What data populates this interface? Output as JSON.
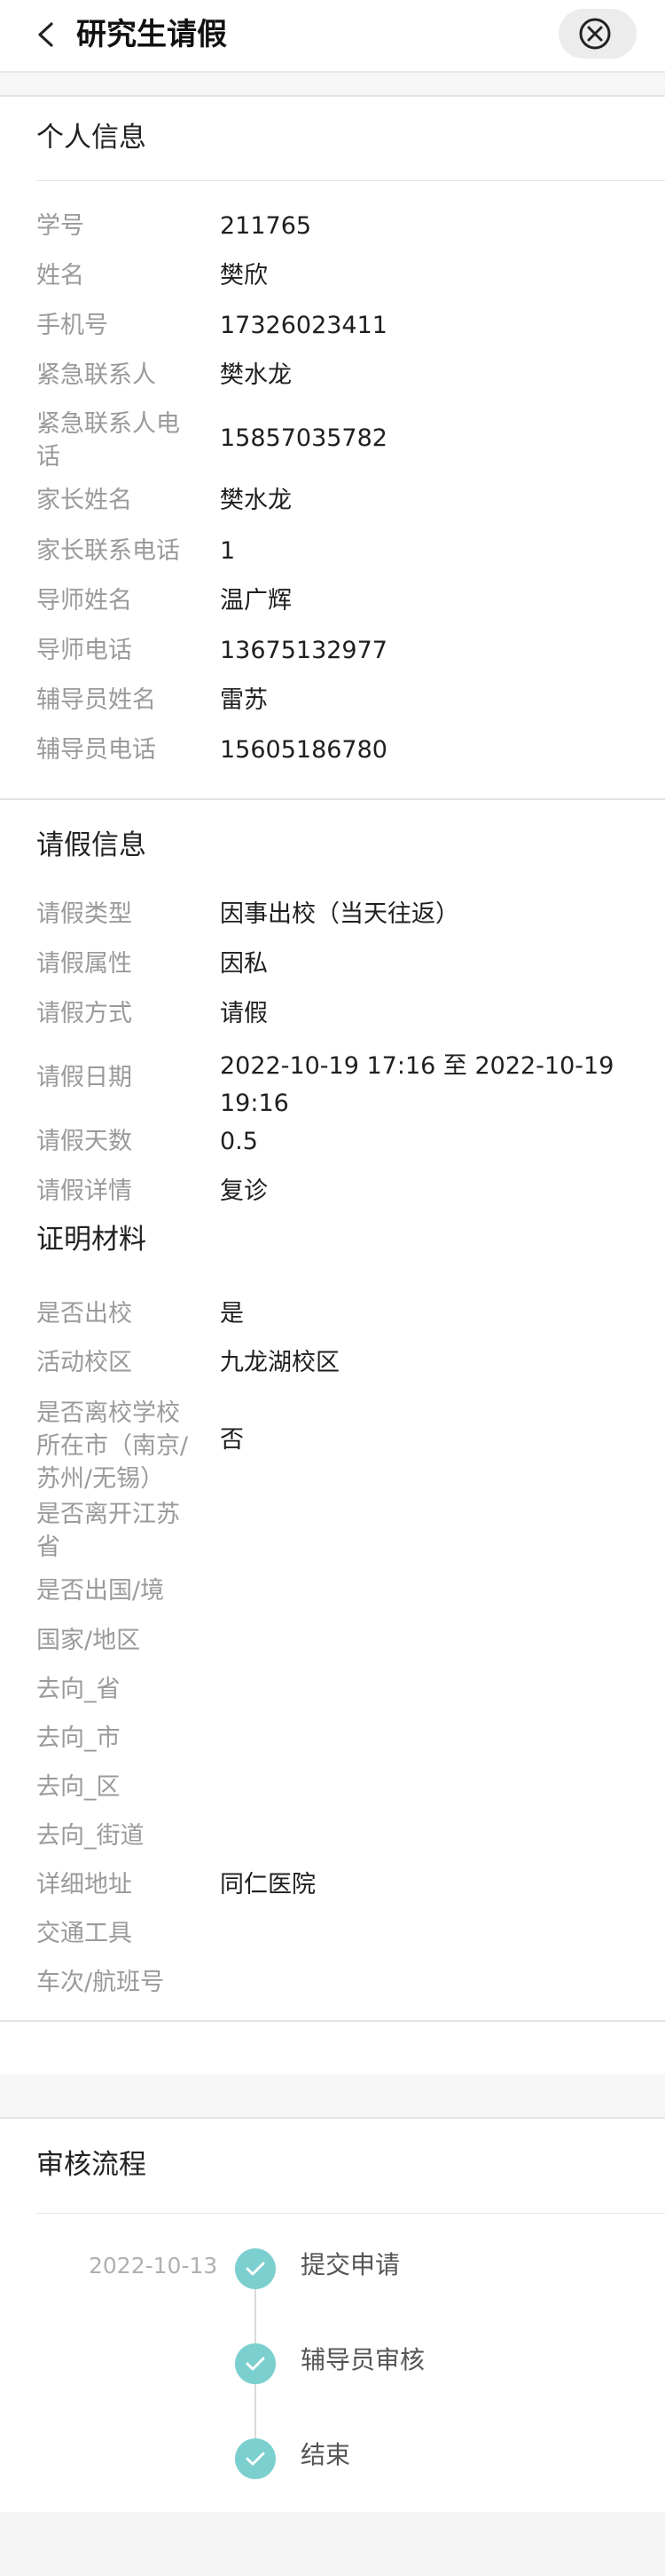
{
  "header": {
    "title": "研究生请假"
  },
  "personal": {
    "title": "个人信息",
    "rows": [
      {
        "label": "学号",
        "value": "211765"
      },
      {
        "label": "姓名",
        "value": "樊欣"
      },
      {
        "label": "手机号",
        "value": "17326023411"
      },
      {
        "label": "紧急联系人",
        "value": "樊水龙"
      },
      {
        "label": "紧急联系人电话",
        "value": "15857035782"
      },
      {
        "label": "家长姓名",
        "value": "樊水龙"
      },
      {
        "label": "家长联系电话",
        "value": "1"
      },
      {
        "label": "导师姓名",
        "value": "温广辉"
      },
      {
        "label": "导师电话",
        "value": "13675132977"
      },
      {
        "label": "辅导员姓名",
        "value": "雷苏"
      },
      {
        "label": "辅导员电话",
        "value": "15605186780"
      }
    ]
  },
  "leave": {
    "title": "请假信息",
    "rows": [
      {
        "label": "请假类型",
        "value": "因事出校（当天往返）"
      },
      {
        "label": "请假属性",
        "value": "因私"
      },
      {
        "label": "请假方式",
        "value": "请假"
      },
      {
        "label": "请假日期",
        "value": "2022-10-19  17:16 至 2022-10-19 19:16"
      },
      {
        "label": "请假天数",
        "value": "0.5"
      },
      {
        "label": "请假详情",
        "value": "复诊"
      }
    ]
  },
  "proof": {
    "title": "证明材料",
    "rows": [
      {
        "label": "是否出校",
        "value": "是"
      },
      {
        "label": "活动校区",
        "value": "九龙湖校区"
      },
      {
        "label": "是否离校学校所在市（南京/苏州/无锡）",
        "value": "否"
      },
      {
        "label": "是否离开江苏省",
        "value": ""
      },
      {
        "label": "是否出国/境",
        "value": ""
      },
      {
        "label": "国家/地区",
        "value": ""
      },
      {
        "label": "去向_省",
        "value": ""
      },
      {
        "label": "去向_市",
        "value": ""
      },
      {
        "label": "去向_区",
        "value": ""
      },
      {
        "label": "去向_街道",
        "value": ""
      },
      {
        "label": "详细地址",
        "value": "同仁医院"
      },
      {
        "label": "交通工具",
        "value": ""
      },
      {
        "label": "车次/航班号",
        "value": ""
      }
    ]
  },
  "process": {
    "title": "审核流程",
    "first_date": "2022-10-13",
    "steps": [
      {
        "label": "提交申请"
      },
      {
        "label": "辅导员审核"
      },
      {
        "label": "结束"
      }
    ]
  },
  "colors": {
    "accent": "#7ccfcf",
    "label": "#9a9a9a",
    "divider": "#e3e3e3"
  }
}
